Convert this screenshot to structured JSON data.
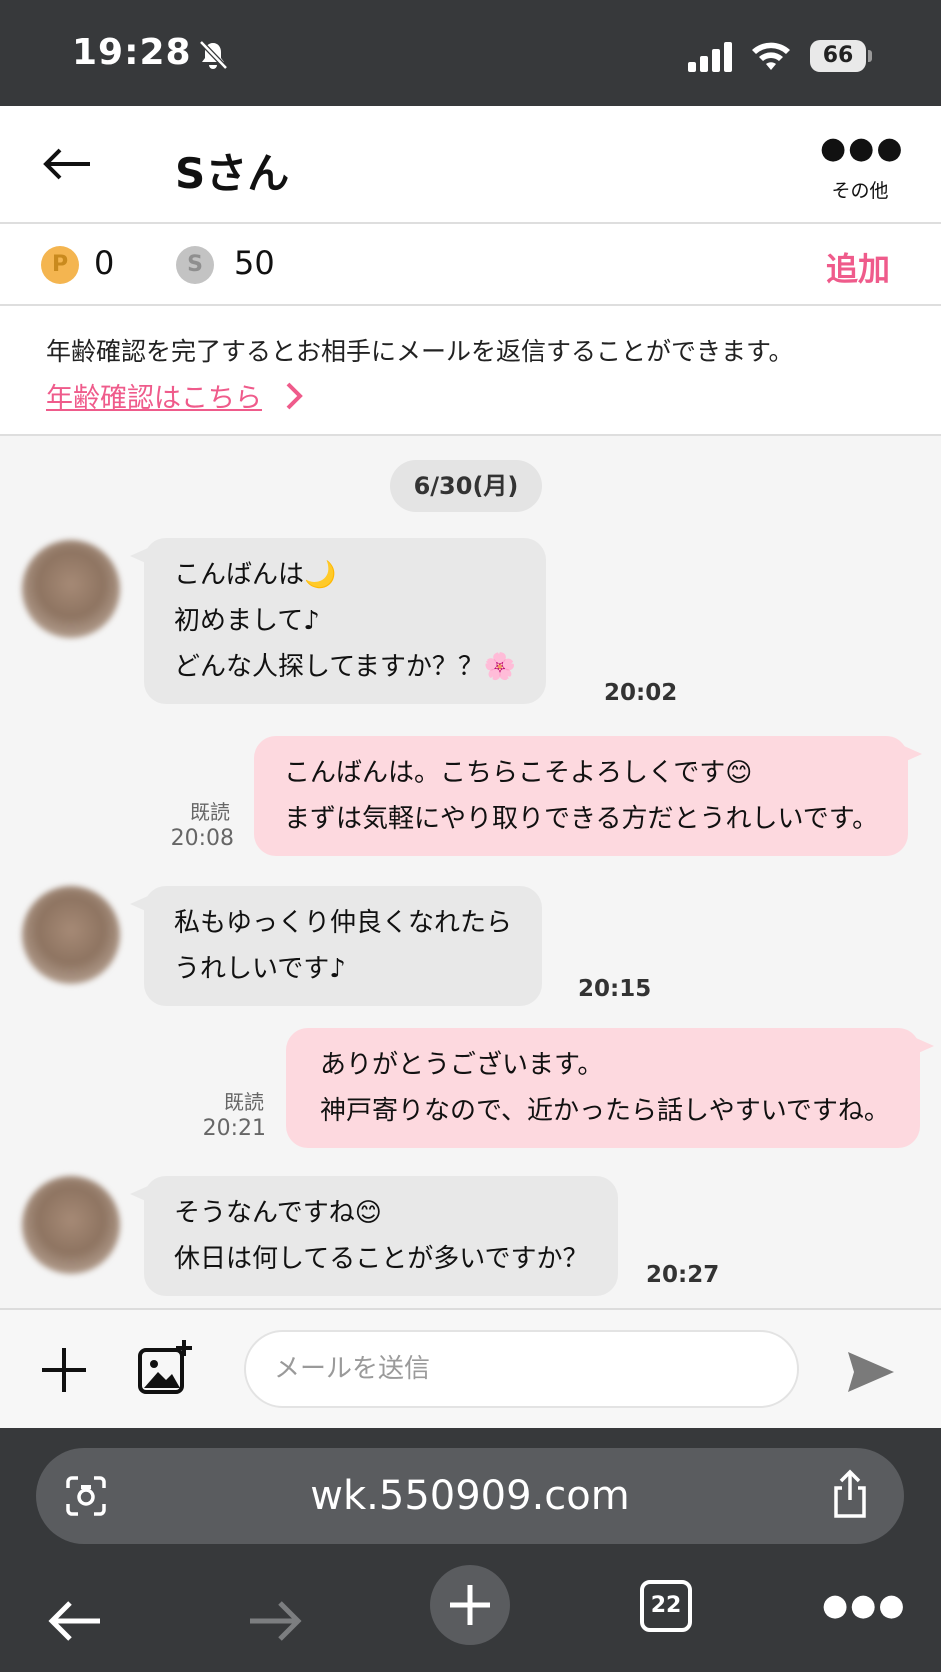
{
  "status_bar": {
    "time": "19:28",
    "battery": "66"
  },
  "header": {
    "title": "Sさん",
    "more_label": "その他"
  },
  "points": {
    "p_label": "P",
    "p_value": "0",
    "s_label": "S",
    "s_value": "50",
    "add_label": "追加"
  },
  "notice": {
    "text": "年齢確認を完了するとお相手にメールを返信することができます。",
    "link_label": "年齢確認はこちら"
  },
  "chat": {
    "date": "6/30(月)",
    "messages": [
      {
        "side": "in",
        "lines": [
          "こんばんは🌙",
          "初めまして♪",
          "どんな人探してますか？？🌸"
        ],
        "time": "20:02"
      },
      {
        "side": "out",
        "lines": [
          "こんばんは。こちらこそよろしくです😊",
          "まずは気軽にやり取りできる方だとうれしいです。"
        ],
        "read": "既読",
        "time": "20:08"
      },
      {
        "side": "in",
        "lines": [
          "私もゆっくり仲良くなれたら",
          "うれしいです♪"
        ],
        "time": "20:15"
      },
      {
        "side": "out",
        "lines": [
          "ありがとうございます。",
          "神戸寄りなので、近かったら話しやすいですね。"
        ],
        "read": "既読",
        "time": "20:21"
      },
      {
        "side": "in",
        "lines": [
          "そうなんですね😊",
          "休日は何してることが多いですか？"
        ],
        "time": "20:27"
      }
    ]
  },
  "composer": {
    "placeholder": "メールを送信"
  },
  "browser": {
    "url": "wk.550909.com",
    "tabs_count": "22"
  },
  "colors": {
    "accent_pink": "#ef5b8b",
    "outgoing_bubble": "#fdd9df",
    "incoming_bubble": "#e8e8e8",
    "dark_chrome": "#37393b"
  }
}
